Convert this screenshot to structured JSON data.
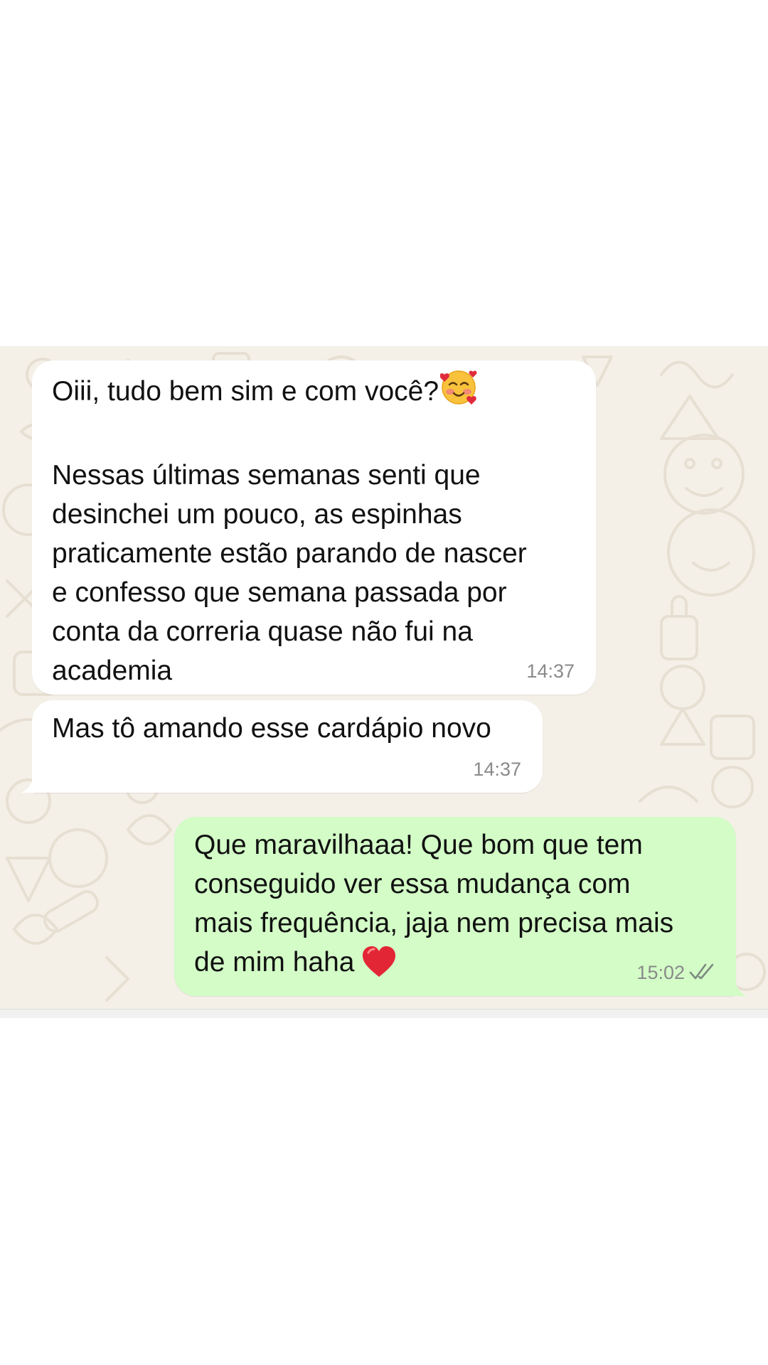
{
  "chat": {
    "messages": [
      {
        "direction": "incoming",
        "text_line1": "Oiii, tudo bem sim e com você?",
        "emoji1": "smiling-face-with-hearts-emoji",
        "text_body": "Nessas últimas semanas senti que\ndesinchei um pouco, as espinhas\npraticamente estão parando de nascer\ne confesso que semana passada por\nconta da correria quase não fui na\nacademia",
        "time": "14:37"
      },
      {
        "direction": "incoming",
        "text": "Mas tô amando esse cardápio novo",
        "time": "14:37"
      },
      {
        "direction": "outgoing",
        "text": "Que maravilhaaa! Que bom que tem\nconseguido ver essa mudança com\nmais frequência, jaja nem precisa mais\nde mim haha",
        "emoji": "red-heart-emoji",
        "time": "15:02",
        "status_icon": "double-check-icon"
      }
    ]
  },
  "colors": {
    "incoming_bubble": "#ffffff",
    "outgoing_bubble": "#d3fcc7",
    "wallpaper": "#f4f0e8",
    "timestamp": "#8a8a8a"
  }
}
